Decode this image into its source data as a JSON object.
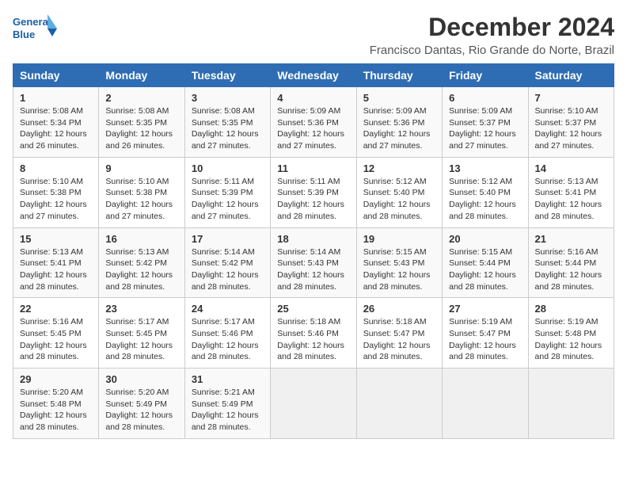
{
  "logo": {
    "line1": "General",
    "line2": "Blue"
  },
  "title": "December 2024",
  "subtitle": "Francisco Dantas, Rio Grande do Norte, Brazil",
  "days_of_week": [
    "Sunday",
    "Monday",
    "Tuesday",
    "Wednesday",
    "Thursday",
    "Friday",
    "Saturday"
  ],
  "weeks": [
    [
      {
        "day": "1",
        "sunrise": "5:08 AM",
        "sunset": "5:34 PM",
        "daylight": "12 hours and 26 minutes."
      },
      {
        "day": "2",
        "sunrise": "5:08 AM",
        "sunset": "5:35 PM",
        "daylight": "12 hours and 26 minutes."
      },
      {
        "day": "3",
        "sunrise": "5:08 AM",
        "sunset": "5:35 PM",
        "daylight": "12 hours and 27 minutes."
      },
      {
        "day": "4",
        "sunrise": "5:09 AM",
        "sunset": "5:36 PM",
        "daylight": "12 hours and 27 minutes."
      },
      {
        "day": "5",
        "sunrise": "5:09 AM",
        "sunset": "5:36 PM",
        "daylight": "12 hours and 27 minutes."
      },
      {
        "day": "6",
        "sunrise": "5:09 AM",
        "sunset": "5:37 PM",
        "daylight": "12 hours and 27 minutes."
      },
      {
        "day": "7",
        "sunrise": "5:10 AM",
        "sunset": "5:37 PM",
        "daylight": "12 hours and 27 minutes."
      }
    ],
    [
      {
        "day": "8",
        "sunrise": "5:10 AM",
        "sunset": "5:38 PM",
        "daylight": "12 hours and 27 minutes."
      },
      {
        "day": "9",
        "sunrise": "5:10 AM",
        "sunset": "5:38 PM",
        "daylight": "12 hours and 27 minutes."
      },
      {
        "day": "10",
        "sunrise": "5:11 AM",
        "sunset": "5:39 PM",
        "daylight": "12 hours and 27 minutes."
      },
      {
        "day": "11",
        "sunrise": "5:11 AM",
        "sunset": "5:39 PM",
        "daylight": "12 hours and 28 minutes."
      },
      {
        "day": "12",
        "sunrise": "5:12 AM",
        "sunset": "5:40 PM",
        "daylight": "12 hours and 28 minutes."
      },
      {
        "day": "13",
        "sunrise": "5:12 AM",
        "sunset": "5:40 PM",
        "daylight": "12 hours and 28 minutes."
      },
      {
        "day": "14",
        "sunrise": "5:13 AM",
        "sunset": "5:41 PM",
        "daylight": "12 hours and 28 minutes."
      }
    ],
    [
      {
        "day": "15",
        "sunrise": "5:13 AM",
        "sunset": "5:41 PM",
        "daylight": "12 hours and 28 minutes."
      },
      {
        "day": "16",
        "sunrise": "5:13 AM",
        "sunset": "5:42 PM",
        "daylight": "12 hours and 28 minutes."
      },
      {
        "day": "17",
        "sunrise": "5:14 AM",
        "sunset": "5:42 PM",
        "daylight": "12 hours and 28 minutes."
      },
      {
        "day": "18",
        "sunrise": "5:14 AM",
        "sunset": "5:43 PM",
        "daylight": "12 hours and 28 minutes."
      },
      {
        "day": "19",
        "sunrise": "5:15 AM",
        "sunset": "5:43 PM",
        "daylight": "12 hours and 28 minutes."
      },
      {
        "day": "20",
        "sunrise": "5:15 AM",
        "sunset": "5:44 PM",
        "daylight": "12 hours and 28 minutes."
      },
      {
        "day": "21",
        "sunrise": "5:16 AM",
        "sunset": "5:44 PM",
        "daylight": "12 hours and 28 minutes."
      }
    ],
    [
      {
        "day": "22",
        "sunrise": "5:16 AM",
        "sunset": "5:45 PM",
        "daylight": "12 hours and 28 minutes."
      },
      {
        "day": "23",
        "sunrise": "5:17 AM",
        "sunset": "5:45 PM",
        "daylight": "12 hours and 28 minutes."
      },
      {
        "day": "24",
        "sunrise": "5:17 AM",
        "sunset": "5:46 PM",
        "daylight": "12 hours and 28 minutes."
      },
      {
        "day": "25",
        "sunrise": "5:18 AM",
        "sunset": "5:46 PM",
        "daylight": "12 hours and 28 minutes."
      },
      {
        "day": "26",
        "sunrise": "5:18 AM",
        "sunset": "5:47 PM",
        "daylight": "12 hours and 28 minutes."
      },
      {
        "day": "27",
        "sunrise": "5:19 AM",
        "sunset": "5:47 PM",
        "daylight": "12 hours and 28 minutes."
      },
      {
        "day": "28",
        "sunrise": "5:19 AM",
        "sunset": "5:48 PM",
        "daylight": "12 hours and 28 minutes."
      }
    ],
    [
      {
        "day": "29",
        "sunrise": "5:20 AM",
        "sunset": "5:48 PM",
        "daylight": "12 hours and 28 minutes."
      },
      {
        "day": "30",
        "sunrise": "5:20 AM",
        "sunset": "5:49 PM",
        "daylight": "12 hours and 28 minutes."
      },
      {
        "day": "31",
        "sunrise": "5:21 AM",
        "sunset": "5:49 PM",
        "daylight": "12 hours and 28 minutes."
      },
      null,
      null,
      null,
      null
    ]
  ],
  "labels": {
    "sunrise": "Sunrise:",
    "sunset": "Sunset:",
    "daylight": "Daylight:"
  }
}
